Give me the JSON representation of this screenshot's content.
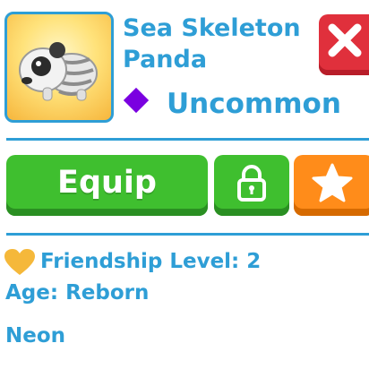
{
  "pet": {
    "name_line1": "Sea Skeleton",
    "name_line2": "Panda",
    "rarity": "Uncommon",
    "rarity_color": "#7a00e0",
    "image_icon": "sea-skeleton-panda-icon"
  },
  "actions": {
    "equip_label": "Equip",
    "lock_icon": "lock-icon",
    "favorite_icon": "star-icon",
    "close_icon": "close-icon"
  },
  "info": {
    "friendship_label": "Friendship Level: 2",
    "age_label": "Age: Reborn",
    "neon_label": "Neon"
  },
  "colors": {
    "accent_blue": "#2e9ed6",
    "equip_green": "#3fbf2f",
    "favorite_orange": "#ff8c1a",
    "close_red": "#e0303c",
    "heart_gold": "#f5b83a"
  }
}
